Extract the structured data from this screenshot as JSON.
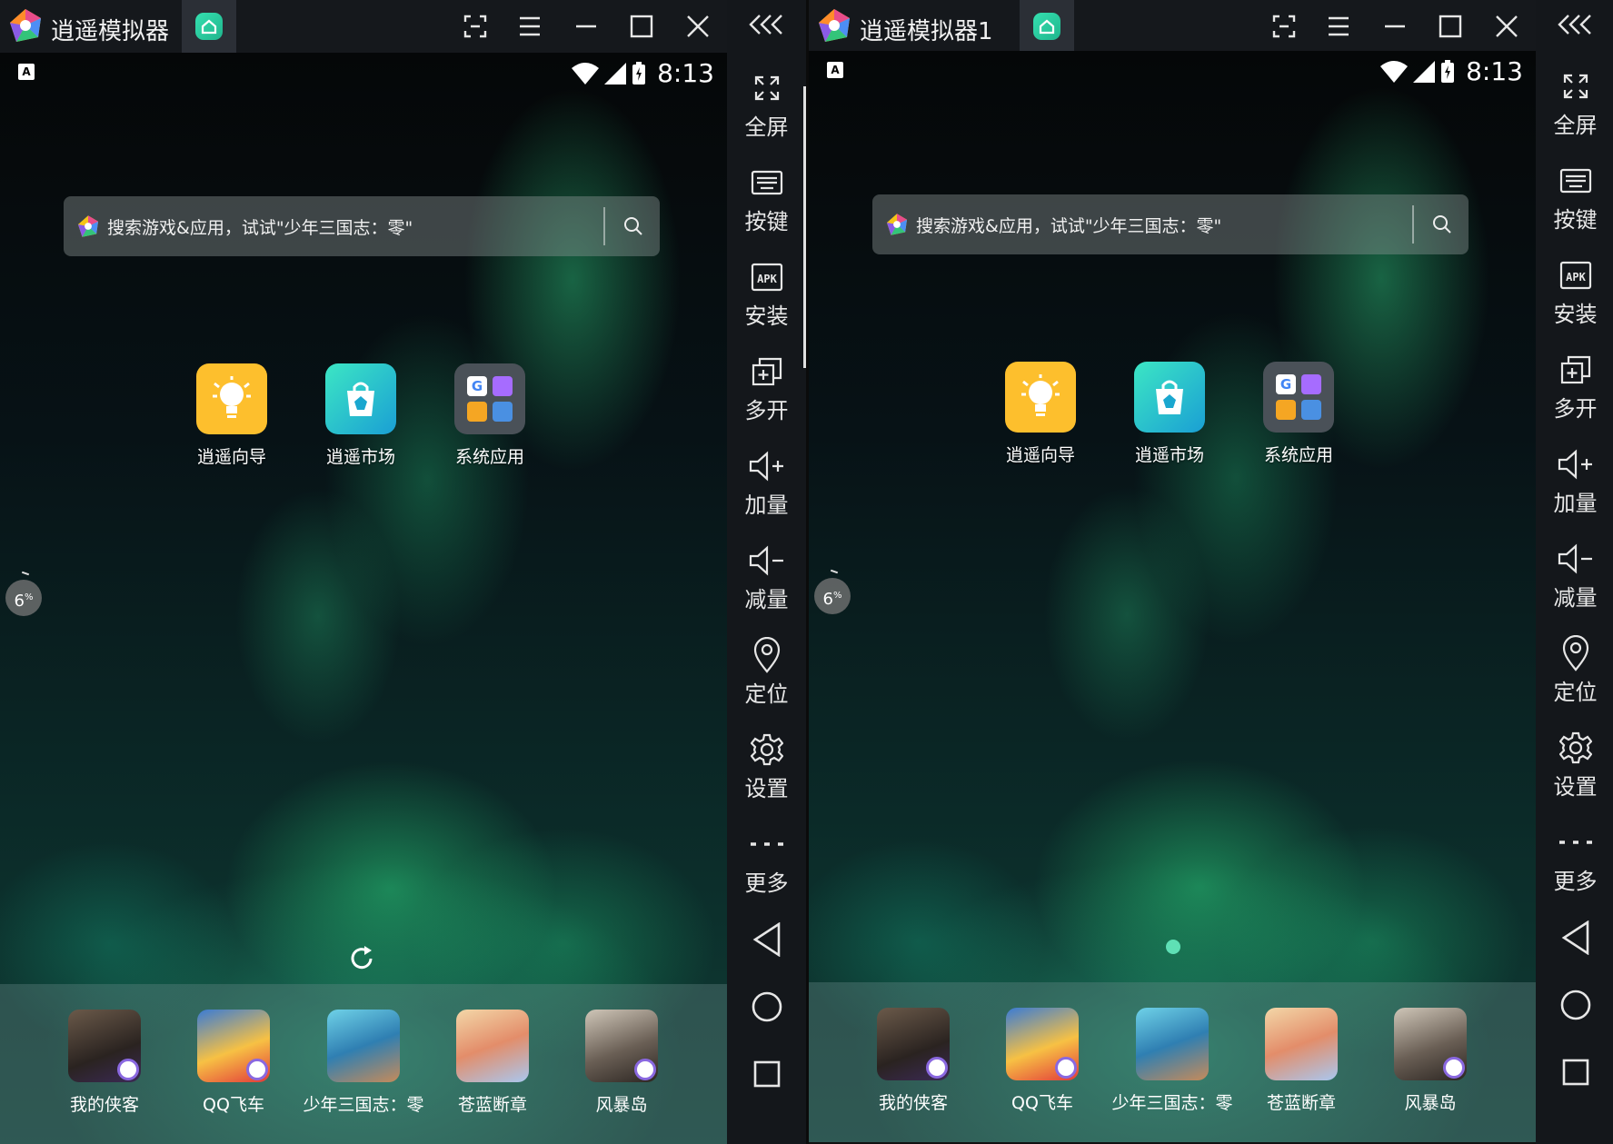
{
  "windows": [
    {
      "title": "逍遥模拟器",
      "status": {
        "time": "8:13",
        "keyboard_indicator": "A"
      },
      "search": {
        "placeholder": "搜索游戏&应用，试试\"少年三国志：零\""
      },
      "apps": [
        {
          "label": "逍遥向导",
          "icon": "lightbulb-icon",
          "color": "#fdbf2d"
        },
        {
          "label": "逍遥市场",
          "icon": "store-bag-icon",
          "color": "#19c2c6"
        },
        {
          "label": "系统应用",
          "icon": "folder-grid-icon",
          "color": "#4a5158"
        }
      ],
      "float_percent": {
        "value": "6",
        "unit": "%"
      },
      "bottom_indicator": "refresh-icon",
      "dock": [
        {
          "label": "我的侠客",
          "icon": "game-wodexiake-icon"
        },
        {
          "label": "QQ飞车",
          "icon": "game-qqfeiche-icon"
        },
        {
          "label": "少年三国志：零",
          "icon": "game-shaonian-sanguozhi-icon"
        },
        {
          "label": "苍蓝断章",
          "icon": "game-canglan-duanzhang-icon"
        },
        {
          "label": "风暴岛",
          "icon": "game-fengbaodao-icon"
        }
      ]
    },
    {
      "title": "逍遥模拟器1",
      "status": {
        "time": "8:13",
        "keyboard_indicator": "A"
      },
      "search": {
        "placeholder": "搜索游戏&应用，试试\"少年三国志：零\""
      },
      "apps": [
        {
          "label": "逍遥向导",
          "icon": "lightbulb-icon",
          "color": "#fdbf2d"
        },
        {
          "label": "逍遥市场",
          "icon": "store-bag-icon",
          "color": "#19c2c6"
        },
        {
          "label": "系统应用",
          "icon": "folder-grid-icon",
          "color": "#4a5158"
        }
      ],
      "float_percent": {
        "value": "6",
        "unit": "%"
      },
      "bottom_indicator": "page-dot",
      "dock": [
        {
          "label": "我的侠客",
          "icon": "game-wodexiake-icon"
        },
        {
          "label": "QQ飞车",
          "icon": "game-qqfeiche-icon"
        },
        {
          "label": "少年三国志：零",
          "icon": "game-shaonian-sanguozhi-icon"
        },
        {
          "label": "苍蓝断章",
          "icon": "game-canglan-duanzhang-icon"
        },
        {
          "label": "风暴岛",
          "icon": "game-fengbaodao-icon"
        }
      ]
    }
  ],
  "sidebar": {
    "items": [
      {
        "label": "全屏",
        "icon": "fullscreen-icon"
      },
      {
        "label": "按键",
        "icon": "keyboard-icon"
      },
      {
        "label": "安装",
        "icon": "apk-icon"
      },
      {
        "label": "多开",
        "icon": "multi-instance-icon"
      },
      {
        "label": "加量",
        "icon": "volume-up-icon"
      },
      {
        "label": "减量",
        "icon": "volume-down-icon"
      },
      {
        "label": "定位",
        "icon": "location-pin-icon"
      },
      {
        "label": "设置",
        "icon": "gear-icon"
      },
      {
        "label": "更多",
        "icon": "more-dots-icon"
      }
    ],
    "nav": [
      "back-icon",
      "home-circle-icon",
      "recents-square-icon"
    ]
  },
  "colors": {
    "titlebar_bg": "#15181c",
    "sidebar_bg": "#14171b",
    "accent_green": "#2fd3a0",
    "wizard_yellow": "#fdbf2d",
    "market_teal": "#19c2c6"
  }
}
